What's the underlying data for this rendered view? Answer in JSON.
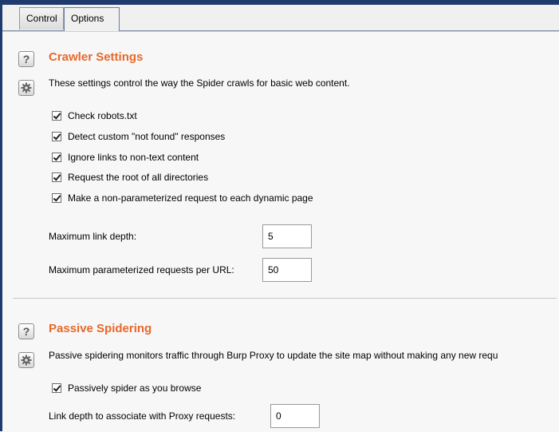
{
  "tabs": [
    {
      "label": "Control"
    },
    {
      "label": "Options"
    }
  ],
  "crawler": {
    "title": "Crawler Settings",
    "description": "These settings control the way the Spider crawls for basic web content.",
    "checkboxes": [
      {
        "label": "Check robots.txt",
        "checked": true
      },
      {
        "label": "Detect custom \"not found\" responses",
        "checked": true
      },
      {
        "label": "Ignore links to non-text content",
        "checked": true
      },
      {
        "label": "Request the root of all directories",
        "checked": true
      },
      {
        "label": "Make a non-parameterized request to each dynamic page",
        "checked": true
      }
    ],
    "max_link_depth_label": "Maximum link depth:",
    "max_link_depth_value": "5",
    "max_param_requests_label": "Maximum parameterized requests per URL:",
    "max_param_requests_value": "50"
  },
  "passive": {
    "title": "Passive Spidering",
    "description": "Passive spidering monitors traffic through Burp Proxy to update the site map without making any new requ",
    "checkbox_label": "Passively spider as you browse",
    "checkbox_checked": true,
    "link_depth_label": "Link depth to associate with Proxy requests:",
    "link_depth_value": "0"
  },
  "icons": {
    "help": "question-mark-icon",
    "settings": "gear-icon"
  },
  "colors": {
    "section_title": "#e8682a",
    "frame": "#1f3a6e"
  }
}
